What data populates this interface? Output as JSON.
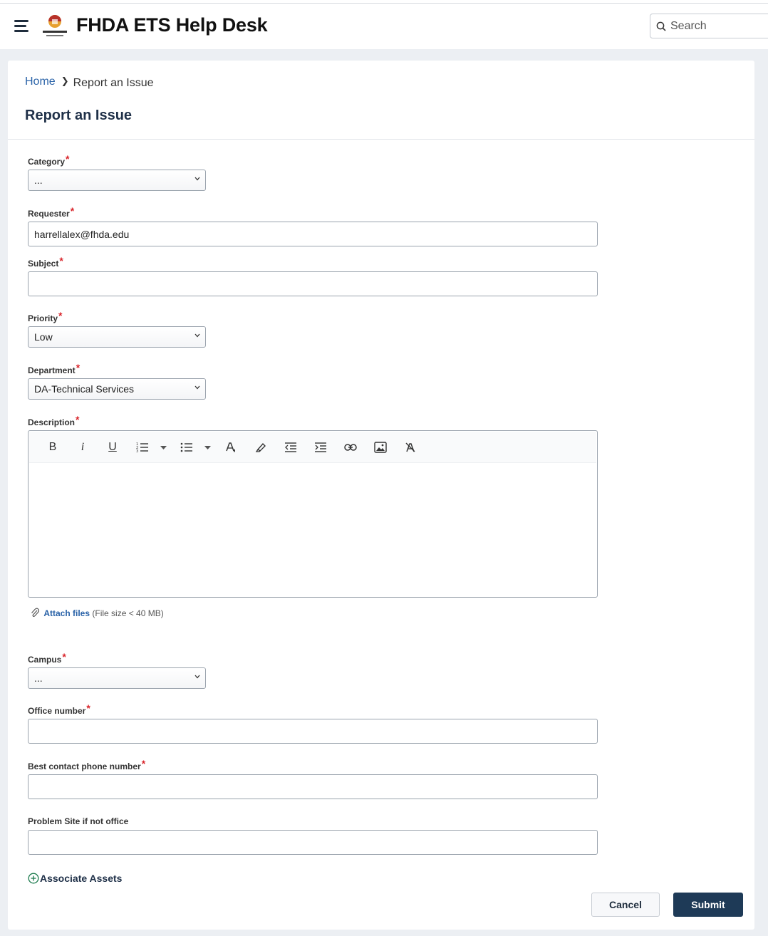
{
  "header": {
    "app_title": "FHDA ETS Help Desk",
    "search_placeholder": "Search"
  },
  "breadcrumb": {
    "home": "Home",
    "current": "Report an Issue"
  },
  "page_title": "Report an Issue",
  "form": {
    "category": {
      "label": "Category",
      "value": "..."
    },
    "requester": {
      "label": "Requester",
      "value": "harrellalex@fhda.edu"
    },
    "subject": {
      "label": "Subject",
      "value": ""
    },
    "priority": {
      "label": "Priority",
      "value": "Low"
    },
    "department": {
      "label": "Department",
      "value": "DA-Technical Services"
    },
    "description": {
      "label": "Description"
    },
    "attach": {
      "link": "Attach files",
      "hint": "(File size < 40 MB)"
    },
    "campus": {
      "label": "Campus",
      "value": "..."
    },
    "office_number": {
      "label": "Office number",
      "value": ""
    },
    "phone": {
      "label": "Best contact phone number",
      "value": ""
    },
    "problem_site": {
      "label": "Problem Site if not office",
      "value": ""
    },
    "required_mark": "*"
  },
  "toolbar": {
    "bold": "B",
    "italic": "i",
    "underline": "U"
  },
  "associate_assets": "Associate Assets",
  "buttons": {
    "cancel": "Cancel",
    "submit": "Submit"
  },
  "colors": {
    "link": "#2a63a8",
    "required": "#d9262c",
    "primary_button": "#1e3a57",
    "page_background": "#eceff3"
  }
}
